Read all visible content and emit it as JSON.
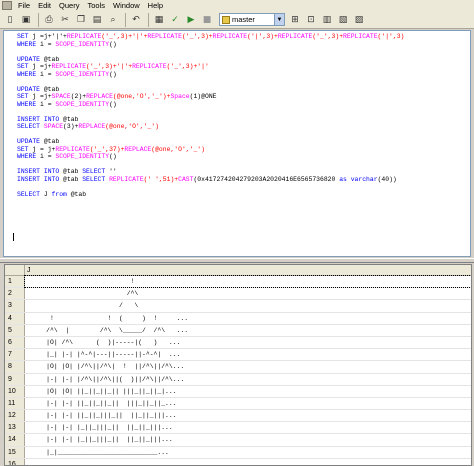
{
  "menubar": {
    "items": [
      "File",
      "Edit",
      "Query",
      "Tools",
      "Window",
      "Help"
    ]
  },
  "toolbar": {
    "database": "master",
    "icons": [
      "open-icon",
      "save-icon",
      "print-icon",
      "cut-icon",
      "copy-icon",
      "paste-icon",
      "find-icon",
      "undo-icon",
      "results-icon",
      "parse-icon",
      "execute-icon",
      "cancel-icon",
      "database-icon",
      "object-browser-icon",
      "object-search-icon",
      "sql-help-icon",
      "properties-icon",
      "grid-icon"
    ]
  },
  "editor": {
    "lines": [
      [
        [
          "SET j =j+'|'+",
          "t"
        ],
        [
          "REPLICATE",
          "f"
        ],
        [
          "('_',3)+'|'+",
          "s"
        ],
        [
          "REPLICATE",
          "f"
        ],
        [
          "('_',3)+",
          "s"
        ],
        [
          "REPLICATE",
          "f"
        ],
        [
          "('|',3)+",
          "s"
        ],
        [
          "REPLICATE",
          "f"
        ],
        [
          "('_',3)+",
          "s"
        ],
        [
          "REPLICATE",
          "f"
        ],
        [
          "('|',3)",
          "s"
        ]
      ],
      [
        [
          "WHERE i = ",
          "t"
        ],
        [
          "SCOPE_IDENTITY",
          "f"
        ],
        [
          "()",
          "t"
        ]
      ],
      [
        [
          "",
          "t"
        ]
      ],
      [
        [
          "UPDATE @tab",
          "t"
        ]
      ],
      [
        [
          "SET j =j+",
          "t"
        ],
        [
          "REPLICATE",
          "f"
        ],
        [
          "('_',3)+'|'+",
          "s"
        ],
        [
          "REPLICATE",
          "f"
        ],
        [
          "('_',3)+'|'",
          "s"
        ]
      ],
      [
        [
          "WHERE i = ",
          "t"
        ],
        [
          "SCOPE_IDENTITY",
          "f"
        ],
        [
          "()",
          "t"
        ]
      ],
      [
        [
          "",
          "t"
        ]
      ],
      [
        [
          "UPDATE @tab",
          "t"
        ]
      ],
      [
        [
          "SET j =j+",
          "t"
        ],
        [
          "SPACE",
          "f"
        ],
        [
          "(2)+",
          "t"
        ],
        [
          "REPLACE",
          "f"
        ],
        [
          "(@one,'O','_')+",
          "s"
        ],
        [
          "Space",
          "f"
        ],
        [
          "(1)",
          "t"
        ],
        [
          "@ONE",
          "t"
        ]
      ],
      [
        [
          "WHERE i = ",
          "t"
        ],
        [
          "SCOPE_IDENTITY",
          "f"
        ],
        [
          "()",
          "t"
        ]
      ],
      [
        [
          "",
          "t"
        ]
      ],
      [
        [
          "INSERT INTO @tab",
          "t"
        ]
      ],
      [
        [
          "SELECT ",
          "t"
        ],
        [
          "SPACE",
          "f"
        ],
        [
          "(3)+",
          "t"
        ],
        [
          "REPLACE",
          "f"
        ],
        [
          "(@one,'O','_')",
          "s"
        ]
      ],
      [
        [
          "",
          "t"
        ]
      ],
      [
        [
          "UPDATE @tab",
          "t"
        ]
      ],
      [
        [
          "SET j = j+",
          "t"
        ],
        [
          "REPLICATE",
          "f"
        ],
        [
          "('_',37)+",
          "s"
        ],
        [
          "REPLACE",
          "f"
        ],
        [
          "(@one,'O','_')",
          "s"
        ]
      ],
      [
        [
          "WHERE i = ",
          "t"
        ],
        [
          "SCOPE_IDENTITY",
          "f"
        ],
        [
          "()",
          "t"
        ]
      ],
      [
        [
          "",
          "t"
        ]
      ],
      [
        [
          "INSERT INTO @tab SELECT ''",
          "t"
        ]
      ],
      [
        [
          "INSERT INTO @tab SELECT ",
          "t"
        ],
        [
          "REPLICATE",
          "f"
        ],
        [
          "(' ',51)+",
          "s"
        ],
        [
          "CAST",
          "f"
        ],
        [
          "(0x417274204279203A2020416E6565736820 as varchar(40))",
          "t"
        ]
      ],
      [
        [
          "",
          "t"
        ]
      ],
      [
        [
          "SELECT J from @tab",
          "t"
        ]
      ]
    ]
  },
  "grid": {
    "column_header": "J",
    "rows": [
      {
        "num": "1",
        "text": "                           !"
      },
      {
        "num": "2",
        "text": "                          /^\\"
      },
      {
        "num": "3",
        "text": "                        /   \\"
      },
      {
        "num": "4",
        "text": "      !              !  (     )  !     ..."
      },
      {
        "num": "5",
        "text": "     /^\\  |        /^\\  \\_____/  /^\\   ..."
      },
      {
        "num": "6",
        "text": "     |O| /^\\      (  )|-----|(   )   ..."
      },
      {
        "num": "7",
        "text": "     |_| |-| |^-^|---||-----||-^-^|  ..."
      },
      {
        "num": "8",
        "text": "     |O| |O| |/^\\||/^\\|  !  ||/^\\||/^\\..."
      },
      {
        "num": "9",
        "text": "     |-| |-| |/^\\||/^\\||(  )||/^\\||/^\\..."
      },
      {
        "num": "10",
        "text": "     |O| |O| ||_||_||_|| |||_||_||_|..."
      },
      {
        "num": "11",
        "text": "     |-| |-| ||_||_||_||  |||_||_||_..."
      },
      {
        "num": "12",
        "text": "     |-| |-| ||_||_|||_||  ||_||_|||..."
      },
      {
        "num": "13",
        "text": "     |-| |-| |_||_|||_||  ||_||_|||..."
      },
      {
        "num": "14",
        "text": "     |-| |-| |_||_|||_||  ||_||_|||..."
      },
      {
        "num": "15",
        "text": "     |_|__________________________..."
      },
      {
        "num": "16",
        "text": ""
      }
    ]
  }
}
